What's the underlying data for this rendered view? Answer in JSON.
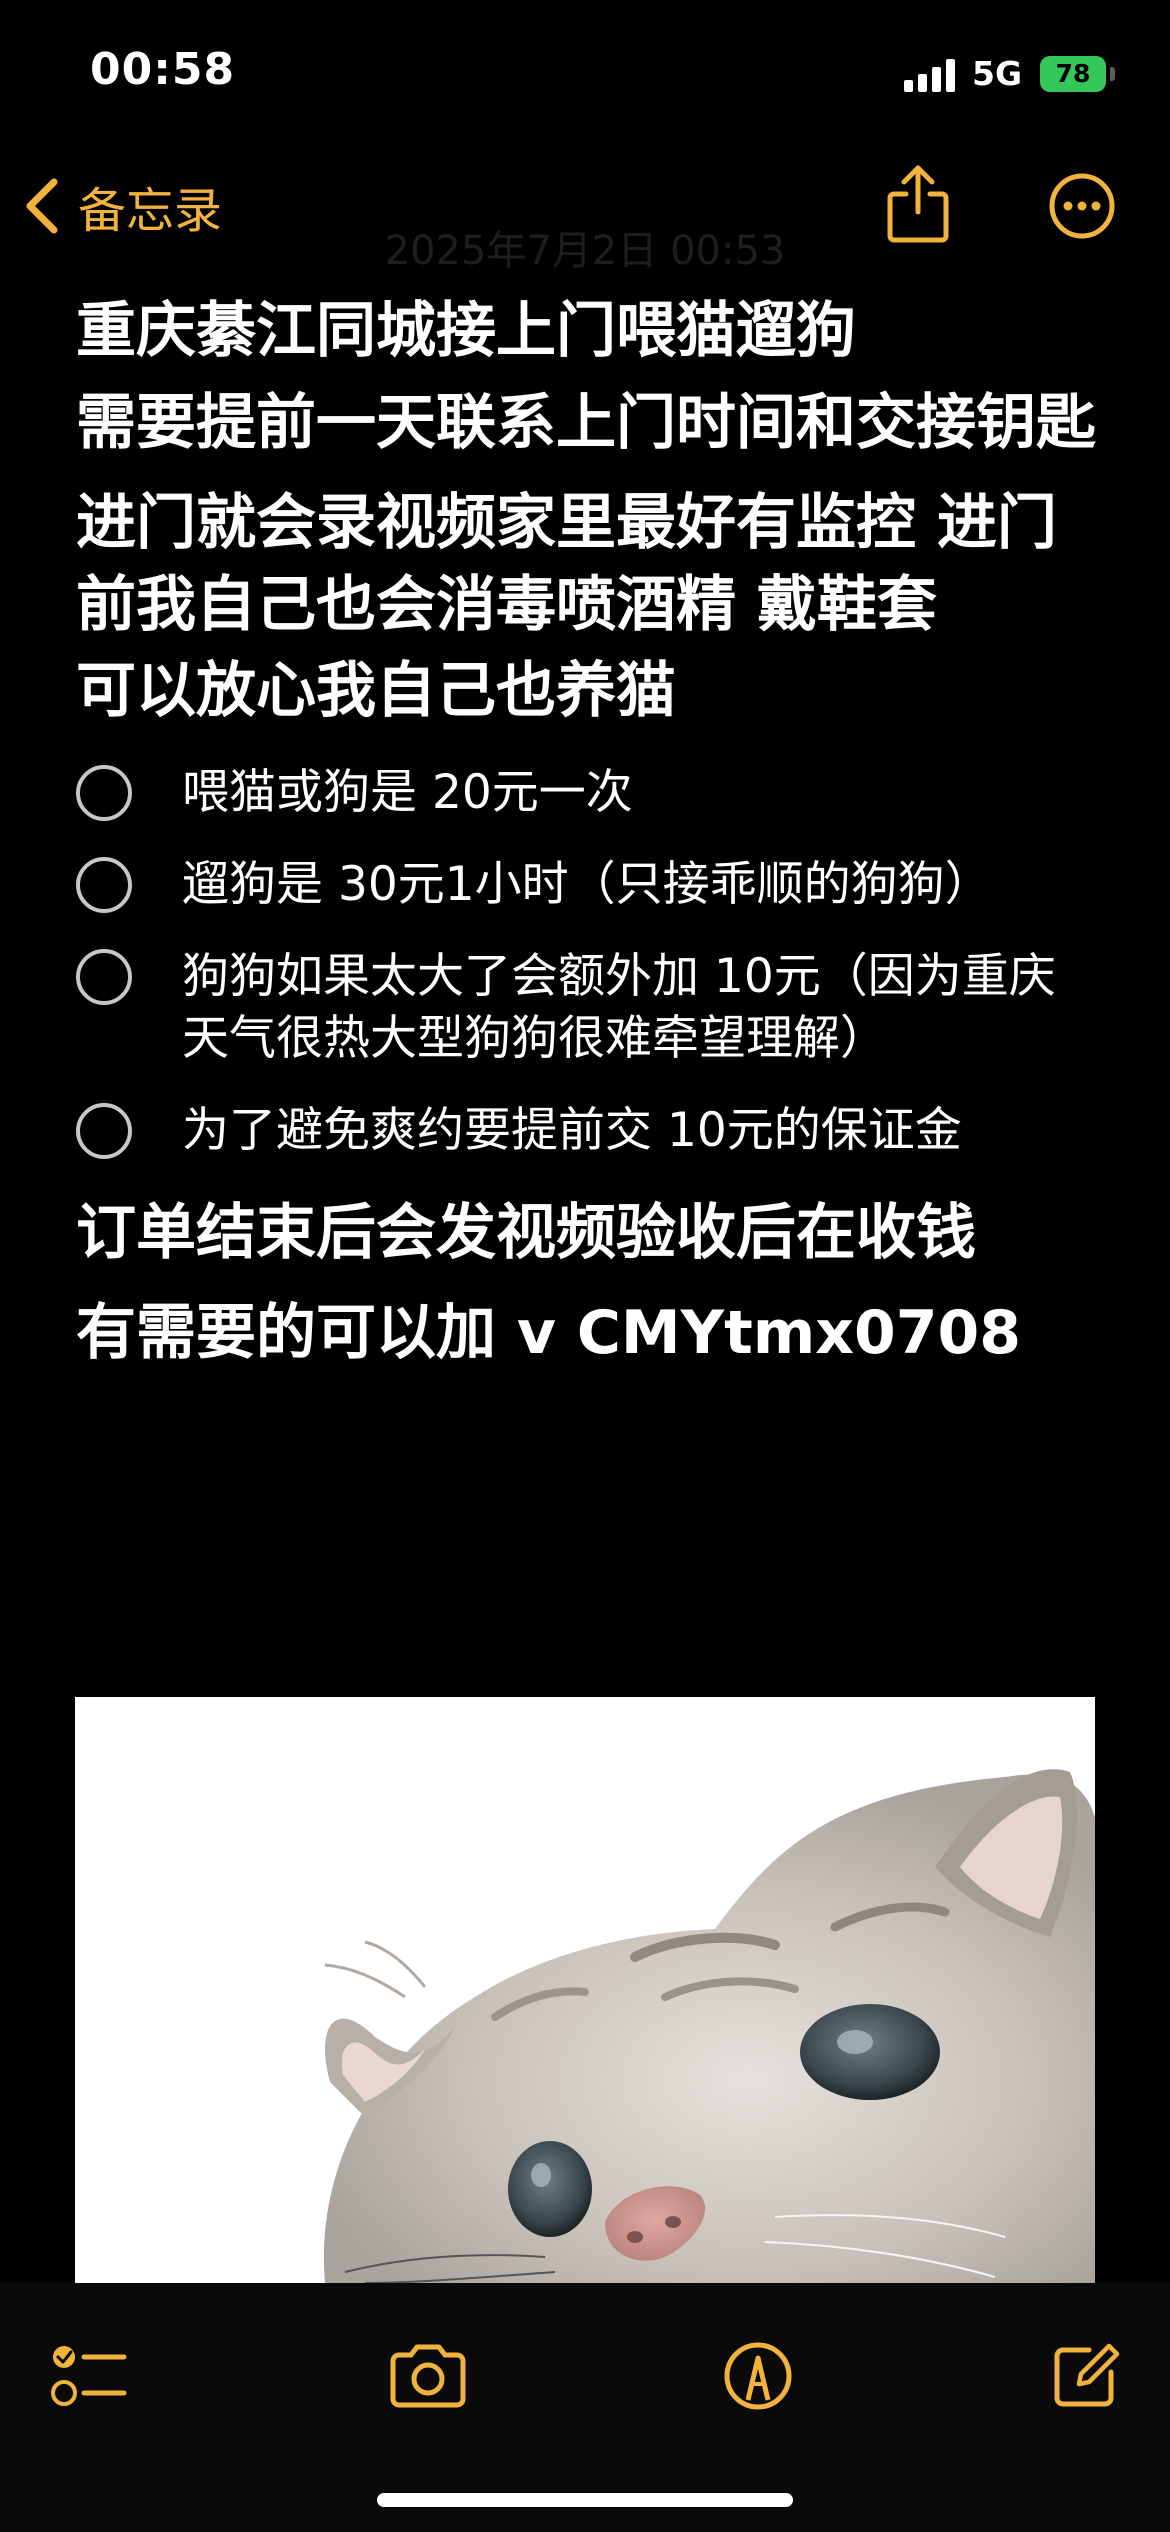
{
  "status_bar": {
    "time": "00:58",
    "network": "5G",
    "battery": "78"
  },
  "nav": {
    "back_label": "备忘录",
    "date_header": "2025年7月2日 00:53"
  },
  "note": {
    "title": "重庆綦江同城接上门喂猫遛狗",
    "paragraphs": [
      "需要提前一天联系上门时间和交接钥匙",
      "进门就会录视频家里最好有监控 进门前我自己也会消毒喷酒精 戴鞋套",
      "可以放心我自己也养猫"
    ],
    "checklist": [
      "喂猫或狗是 20元一次",
      "遛狗是 30元1小时（只接乖顺的狗狗）",
      "狗狗如果太大了会额外加 10元（因为重庆天气很热大型狗狗很难牵望理解）",
      "为了避免爽约要提前交 10元的保证金"
    ],
    "closing": [
      "订单结束后会发视频验收后在收钱",
      "有需要的可以加 v CMYtmx0708"
    ]
  },
  "icons": {
    "back": "chevron-left-icon",
    "share": "share-icon",
    "more": "ellipsis-circle-icon",
    "checklist": "checklist-icon",
    "camera": "camera-icon",
    "markup": "markup-pen-icon",
    "compose": "compose-icon"
  },
  "colors": {
    "accent": "#f2b33d",
    "background": "#000000",
    "text": "#ffffff",
    "battery": "#34c759"
  }
}
